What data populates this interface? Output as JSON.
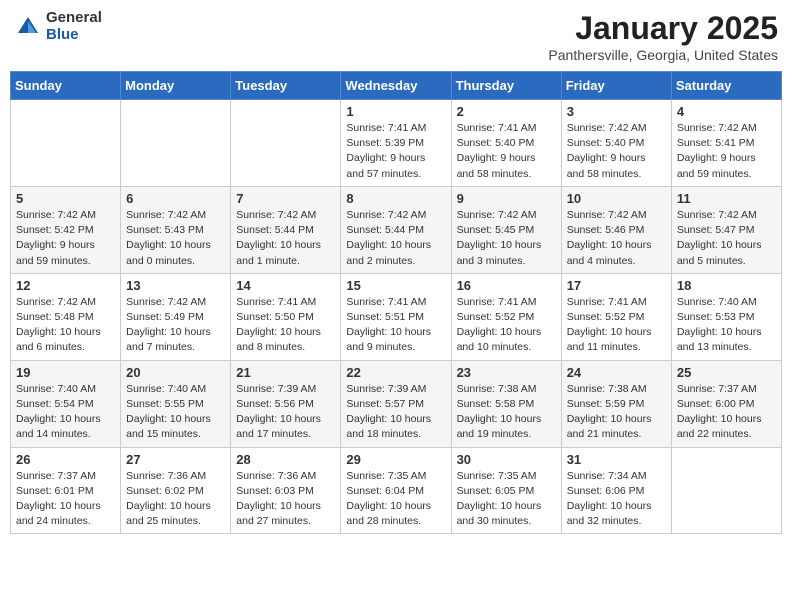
{
  "header": {
    "logo_general": "General",
    "logo_blue": "Blue",
    "month_title": "January 2025",
    "location": "Panthersville, Georgia, United States"
  },
  "days_of_week": [
    "Sunday",
    "Monday",
    "Tuesday",
    "Wednesday",
    "Thursday",
    "Friday",
    "Saturday"
  ],
  "weeks": [
    {
      "cells": [
        {
          "day": "",
          "info": ""
        },
        {
          "day": "",
          "info": ""
        },
        {
          "day": "",
          "info": ""
        },
        {
          "day": "1",
          "info": "Sunrise: 7:41 AM\nSunset: 5:39 PM\nDaylight: 9 hours\nand 57 minutes."
        },
        {
          "day": "2",
          "info": "Sunrise: 7:41 AM\nSunset: 5:40 PM\nDaylight: 9 hours\nand 58 minutes."
        },
        {
          "day": "3",
          "info": "Sunrise: 7:42 AM\nSunset: 5:40 PM\nDaylight: 9 hours\nand 58 minutes."
        },
        {
          "day": "4",
          "info": "Sunrise: 7:42 AM\nSunset: 5:41 PM\nDaylight: 9 hours\nand 59 minutes."
        }
      ]
    },
    {
      "cells": [
        {
          "day": "5",
          "info": "Sunrise: 7:42 AM\nSunset: 5:42 PM\nDaylight: 9 hours\nand 59 minutes."
        },
        {
          "day": "6",
          "info": "Sunrise: 7:42 AM\nSunset: 5:43 PM\nDaylight: 10 hours\nand 0 minutes."
        },
        {
          "day": "7",
          "info": "Sunrise: 7:42 AM\nSunset: 5:44 PM\nDaylight: 10 hours\nand 1 minute."
        },
        {
          "day": "8",
          "info": "Sunrise: 7:42 AM\nSunset: 5:44 PM\nDaylight: 10 hours\nand 2 minutes."
        },
        {
          "day": "9",
          "info": "Sunrise: 7:42 AM\nSunset: 5:45 PM\nDaylight: 10 hours\nand 3 minutes."
        },
        {
          "day": "10",
          "info": "Sunrise: 7:42 AM\nSunset: 5:46 PM\nDaylight: 10 hours\nand 4 minutes."
        },
        {
          "day": "11",
          "info": "Sunrise: 7:42 AM\nSunset: 5:47 PM\nDaylight: 10 hours\nand 5 minutes."
        }
      ]
    },
    {
      "cells": [
        {
          "day": "12",
          "info": "Sunrise: 7:42 AM\nSunset: 5:48 PM\nDaylight: 10 hours\nand 6 minutes."
        },
        {
          "day": "13",
          "info": "Sunrise: 7:42 AM\nSunset: 5:49 PM\nDaylight: 10 hours\nand 7 minutes."
        },
        {
          "day": "14",
          "info": "Sunrise: 7:41 AM\nSunset: 5:50 PM\nDaylight: 10 hours\nand 8 minutes."
        },
        {
          "day": "15",
          "info": "Sunrise: 7:41 AM\nSunset: 5:51 PM\nDaylight: 10 hours\nand 9 minutes."
        },
        {
          "day": "16",
          "info": "Sunrise: 7:41 AM\nSunset: 5:52 PM\nDaylight: 10 hours\nand 10 minutes."
        },
        {
          "day": "17",
          "info": "Sunrise: 7:41 AM\nSunset: 5:52 PM\nDaylight: 10 hours\nand 11 minutes."
        },
        {
          "day": "18",
          "info": "Sunrise: 7:40 AM\nSunset: 5:53 PM\nDaylight: 10 hours\nand 13 minutes."
        }
      ]
    },
    {
      "cells": [
        {
          "day": "19",
          "info": "Sunrise: 7:40 AM\nSunset: 5:54 PM\nDaylight: 10 hours\nand 14 minutes."
        },
        {
          "day": "20",
          "info": "Sunrise: 7:40 AM\nSunset: 5:55 PM\nDaylight: 10 hours\nand 15 minutes."
        },
        {
          "day": "21",
          "info": "Sunrise: 7:39 AM\nSunset: 5:56 PM\nDaylight: 10 hours\nand 17 minutes."
        },
        {
          "day": "22",
          "info": "Sunrise: 7:39 AM\nSunset: 5:57 PM\nDaylight: 10 hours\nand 18 minutes."
        },
        {
          "day": "23",
          "info": "Sunrise: 7:38 AM\nSunset: 5:58 PM\nDaylight: 10 hours\nand 19 minutes."
        },
        {
          "day": "24",
          "info": "Sunrise: 7:38 AM\nSunset: 5:59 PM\nDaylight: 10 hours\nand 21 minutes."
        },
        {
          "day": "25",
          "info": "Sunrise: 7:37 AM\nSunset: 6:00 PM\nDaylight: 10 hours\nand 22 minutes."
        }
      ]
    },
    {
      "cells": [
        {
          "day": "26",
          "info": "Sunrise: 7:37 AM\nSunset: 6:01 PM\nDaylight: 10 hours\nand 24 minutes."
        },
        {
          "day": "27",
          "info": "Sunrise: 7:36 AM\nSunset: 6:02 PM\nDaylight: 10 hours\nand 25 minutes."
        },
        {
          "day": "28",
          "info": "Sunrise: 7:36 AM\nSunset: 6:03 PM\nDaylight: 10 hours\nand 27 minutes."
        },
        {
          "day": "29",
          "info": "Sunrise: 7:35 AM\nSunset: 6:04 PM\nDaylight: 10 hours\nand 28 minutes."
        },
        {
          "day": "30",
          "info": "Sunrise: 7:35 AM\nSunset: 6:05 PM\nDaylight: 10 hours\nand 30 minutes."
        },
        {
          "day": "31",
          "info": "Sunrise: 7:34 AM\nSunset: 6:06 PM\nDaylight: 10 hours\nand 32 minutes."
        },
        {
          "day": "",
          "info": ""
        }
      ]
    }
  ]
}
